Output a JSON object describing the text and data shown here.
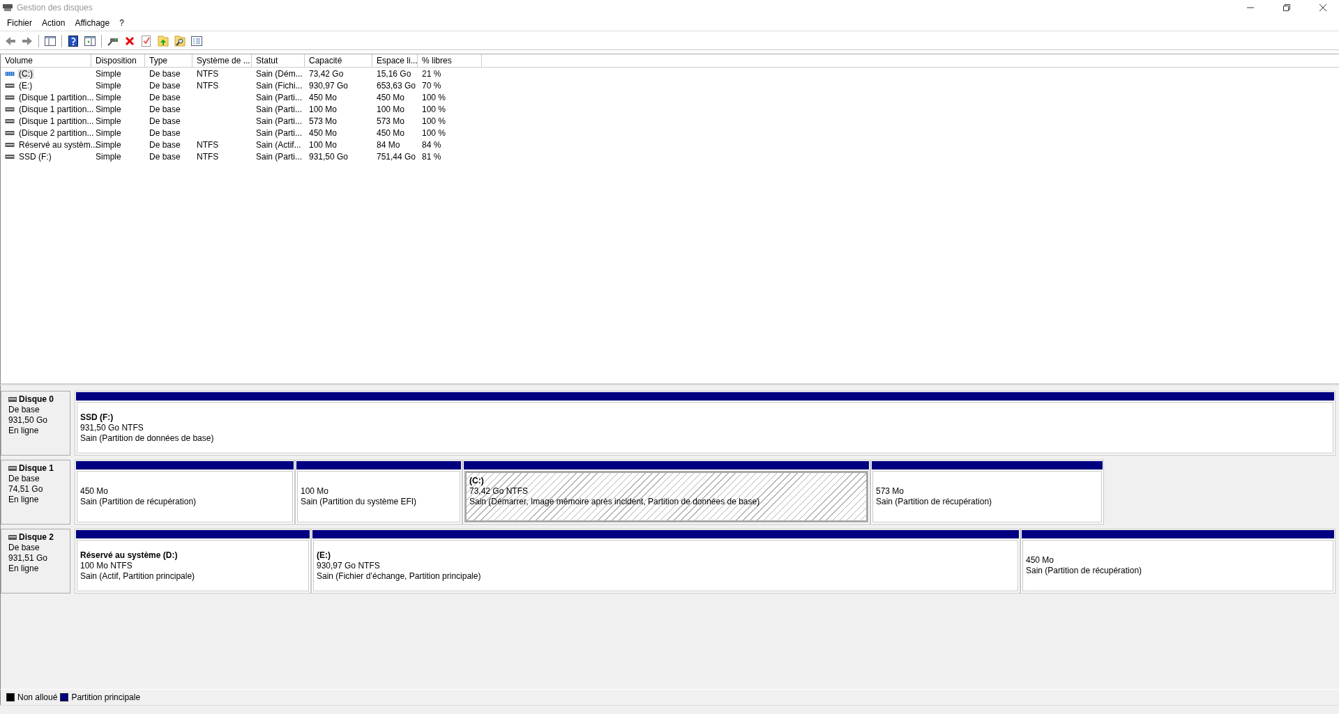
{
  "window": {
    "title": "Gestion des disques"
  },
  "menu": [
    "Fichier",
    "Action",
    "Affichage",
    "?"
  ],
  "table": {
    "columns": [
      "Volume",
      "Disposition",
      "Type",
      "Système de ...",
      "Statut",
      "Capacité",
      "Espace li...",
      "% libres"
    ],
    "rows": [
      {
        "selected": true,
        "kind": "striped",
        "cells": [
          "(C:)",
          "Simple",
          "De base",
          "NTFS",
          "Sain (Dém...",
          "73,42 Go",
          "15,16 Go",
          "21 %"
        ]
      },
      {
        "selected": false,
        "kind": "plain",
        "cells": [
          "(E:)",
          "Simple",
          "De base",
          "NTFS",
          "Sain (Fichi...",
          "930,97 Go",
          "653,63 Go",
          "70 %"
        ]
      },
      {
        "selected": false,
        "kind": "plain",
        "cells": [
          "(Disque 1 partition...",
          "Simple",
          "De base",
          "",
          "Sain (Parti...",
          "450 Mo",
          "450 Mo",
          "100 %"
        ]
      },
      {
        "selected": false,
        "kind": "plain",
        "cells": [
          "(Disque 1 partition...",
          "Simple",
          "De base",
          "",
          "Sain (Parti...",
          "100 Mo",
          "100 Mo",
          "100 %"
        ]
      },
      {
        "selected": false,
        "kind": "plain",
        "cells": [
          "(Disque 1 partition...",
          "Simple",
          "De base",
          "",
          "Sain (Parti...",
          "573 Mo",
          "573 Mo",
          "100 %"
        ]
      },
      {
        "selected": false,
        "kind": "plain",
        "cells": [
          "(Disque 2 partition...",
          "Simple",
          "De base",
          "",
          "Sain (Parti...",
          "450 Mo",
          "450 Mo",
          "100 %"
        ]
      },
      {
        "selected": false,
        "kind": "plain",
        "cells": [
          "Réservé au systèm...",
          "Simple",
          "De base",
          "NTFS",
          "Sain (Actif...",
          "100 Mo",
          "84 Mo",
          "84 %"
        ]
      },
      {
        "selected": false,
        "kind": "plain",
        "cells": [
          "SSD (F:)",
          "Simple",
          "De base",
          "NTFS",
          "Sain (Parti...",
          "931,50 Go",
          "751,44 Go",
          "81 %"
        ]
      }
    ]
  },
  "disks": [
    {
      "name": "Disque 0",
      "type": "De base",
      "size": "931,50 Go",
      "state": "En ligne",
      "partitions": [
        {
          "name": "SSD  (F:)",
          "size": "931,50 Go NTFS",
          "status": "Sain (Partition de données de base)",
          "selected": false
        }
      ]
    },
    {
      "name": "Disque 1",
      "type": "De base",
      "size": "74,51 Go",
      "state": "En ligne",
      "partitions": [
        {
          "size": "450 Mo",
          "status": "Sain (Partition de récupération)",
          "selected": false
        },
        {
          "size": "100 Mo",
          "status": "Sain (Partition du système EFI)",
          "selected": false
        },
        {
          "name": "(C:)",
          "size": "73,42 Go NTFS",
          "status": "Sain (Démarrer, Image mémoire après incident, Partition de données de base)",
          "selected": true
        },
        {
          "size": "573 Mo",
          "status": "Sain (Partition de récupération)",
          "selected": false
        }
      ]
    },
    {
      "name": "Disque 2",
      "type": "De base",
      "size": "931,51 Go",
      "state": "En ligne",
      "partitions": [
        {
          "name": "Réservé au système  (D:)",
          "size": "100 Mo NTFS",
          "status": "Sain (Actif, Partition principale)",
          "selected": false
        },
        {
          "name": "(E:)",
          "size": "930,97 Go NTFS",
          "status": "Sain (Fichier d’échange, Partition principale)",
          "selected": false
        },
        {
          "size": "450 Mo",
          "status": "Sain (Partition de récupération)",
          "selected": false
        }
      ]
    }
  ],
  "legend": [
    {
      "label": "Non alloué",
      "color": "#000000"
    },
    {
      "label": "Partition principale",
      "color": "#000080"
    }
  ]
}
